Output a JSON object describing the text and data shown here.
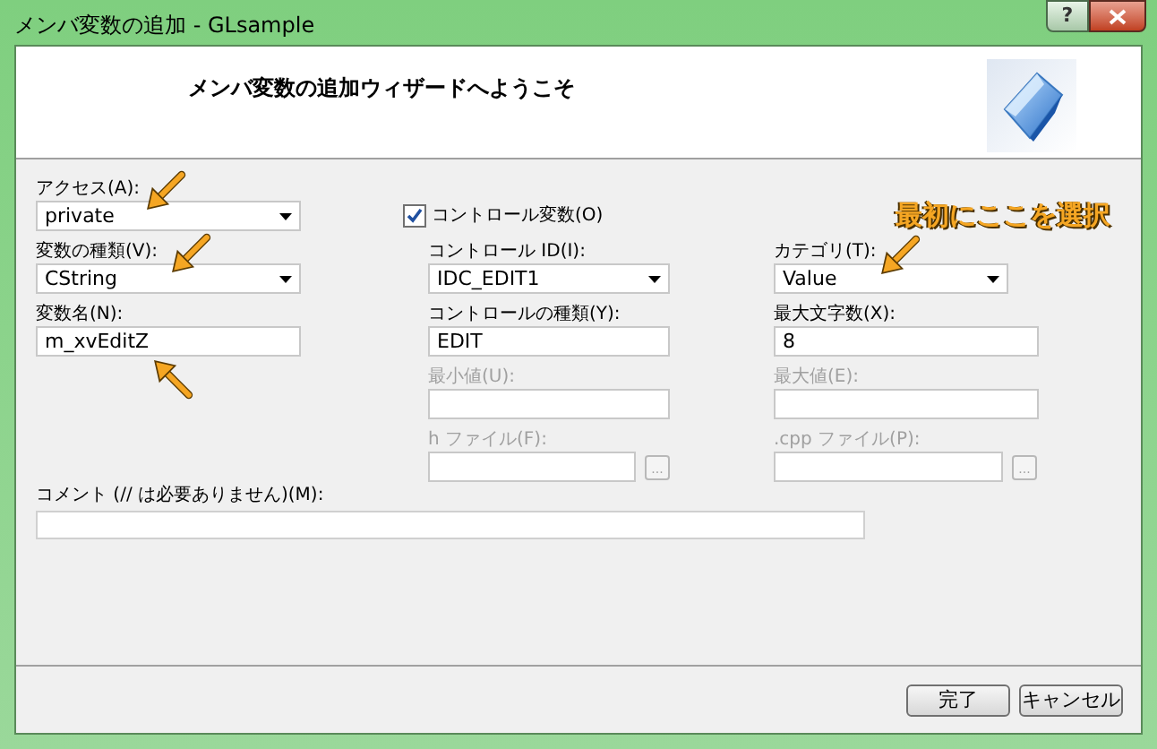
{
  "window": {
    "title": "メンバ変数の追加 - GLsample",
    "help": "?"
  },
  "header": {
    "title": "メンバ変数の追加ウィザードへようこそ"
  },
  "left_fields": [
    {
      "kind": "combo",
      "label": "アクセス(A):",
      "value": "private",
      "disabled": false
    },
    {
      "kind": "combo",
      "label": "変数の種類(V):",
      "value": "CString",
      "disabled": false
    },
    {
      "kind": "text",
      "label": "変数名(N):",
      "value": "m_xvEditZ",
      "disabled": false
    }
  ],
  "control_variable": {
    "label": "コントロール変数(O)",
    "checked": true
  },
  "middle_fields": [
    {
      "kind": "combo",
      "label": "コントロール ID(I):",
      "value": "IDC_EDIT1",
      "disabled": false
    },
    {
      "kind": "text",
      "label": "コントロールの種類(Y):",
      "value": "EDIT",
      "disabled": false
    },
    {
      "kind": "text",
      "label": "最小値(U):",
      "disabled": true
    },
    {
      "kind": "file",
      "label": "h ファイル(F):",
      "disabled": true,
      "browse": "..."
    }
  ],
  "right_fields": [
    {
      "kind": "combo",
      "label": "カテゴリ(T):",
      "value": "Value",
      "disabled": false
    },
    {
      "kind": "text",
      "label": "最大文字数(X):",
      "value": "8",
      "disabled": false
    },
    {
      "kind": "text",
      "label": "最大値(E):",
      "disabled": true
    },
    {
      "kind": "file",
      "label": ".cpp ファイル(P):",
      "disabled": true,
      "browse": "..."
    }
  ],
  "comment": {
    "label": "コメント (// は必要ありません)(M):"
  },
  "annotation": {
    "text": "最初にここを選択"
  },
  "buttons": [
    "完了",
    "キャンセル"
  ]
}
